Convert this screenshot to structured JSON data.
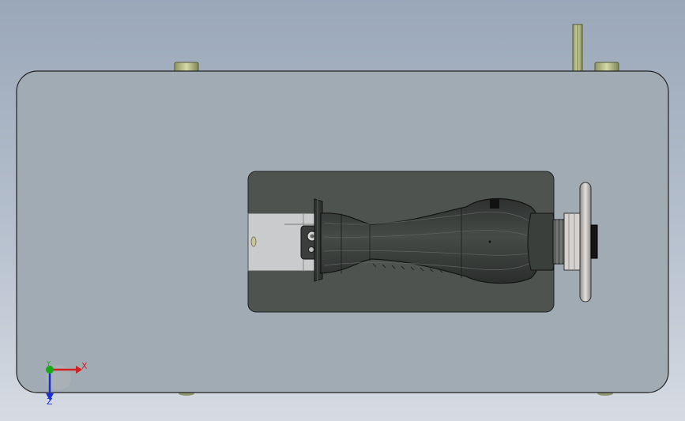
{
  "viewport": {
    "background_top": "#9aa7b8",
    "background_bottom": "#d6dbe3"
  },
  "model": {
    "plate_color": "#a0abb3",
    "cutout_color": "#4f534f",
    "part_color": "#3a3e3b",
    "bracket_color": "#c9cbcc",
    "peg_color": "#b8bf8a",
    "wheel_color": "#c7c3c0"
  },
  "triad": {
    "x_label": "X",
    "y_label": "Y",
    "z_label": "Z",
    "x_color": "#d42020",
    "y_color": "#18a818",
    "z_color": "#1a2fd0"
  }
}
